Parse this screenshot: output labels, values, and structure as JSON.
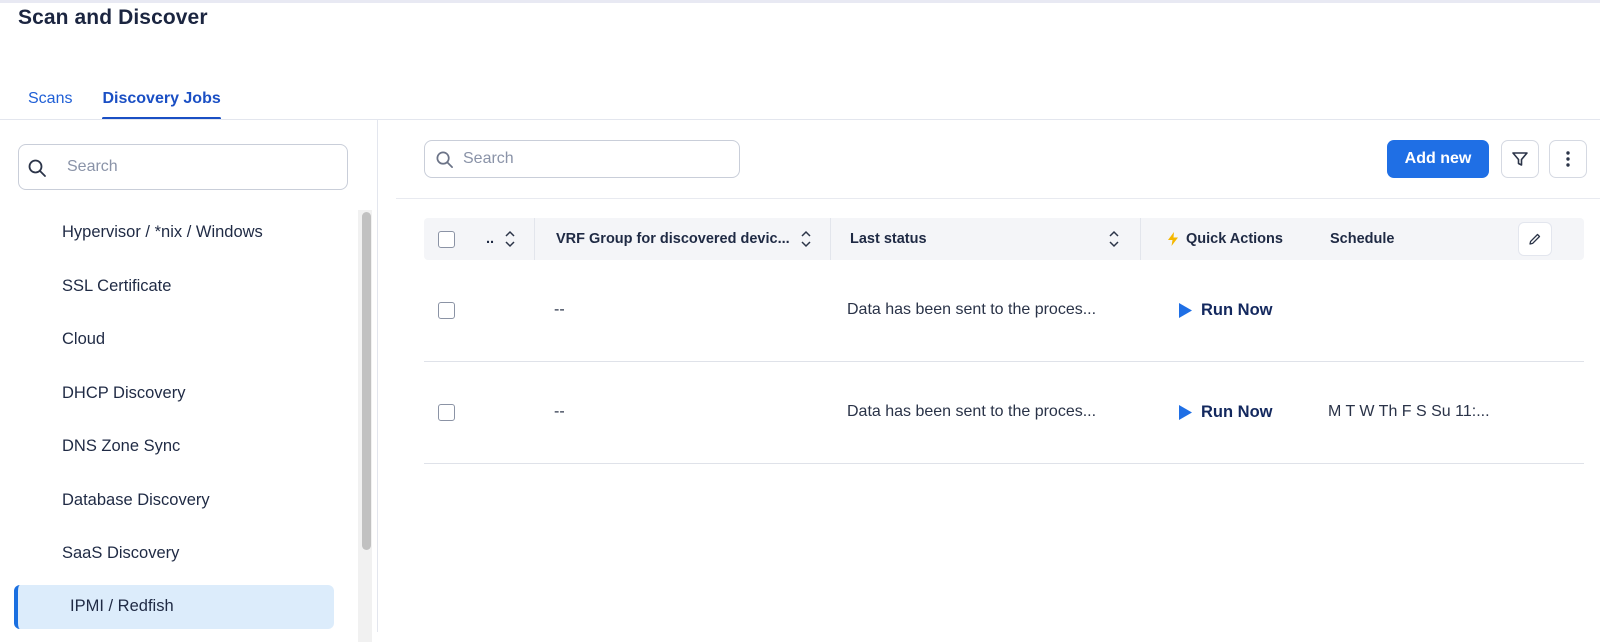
{
  "page": {
    "title": "Scan and Discover"
  },
  "tabs": [
    {
      "label": "Scans"
    },
    {
      "label": "Discovery Jobs"
    }
  ],
  "sidebar": {
    "search_placeholder": "Search",
    "items": [
      {
        "label": "Hypervisor / *nix / Windows"
      },
      {
        "label": "SSL Certificate"
      },
      {
        "label": "Cloud"
      },
      {
        "label": "DHCP Discovery"
      },
      {
        "label": "DNS Zone Sync"
      },
      {
        "label": "Database Discovery"
      },
      {
        "label": "SaaS Discovery"
      },
      {
        "label": "IPMI / Redfish"
      }
    ],
    "selected": "IPMI / Redfish"
  },
  "toolbar": {
    "search_placeholder": "Search",
    "add_label": "Add new"
  },
  "table": {
    "columns": [
      {
        "label": ".."
      },
      {
        "label": "VRF Group for discovered devic..."
      },
      {
        "label": "Last status"
      },
      {
        "label": "Quick Actions"
      },
      {
        "label": "Schedule"
      }
    ],
    "rows": [
      {
        "vrf": "--",
        "last_status": "Data has been sent to the proces...",
        "action": "Run Now",
        "schedule": ""
      },
      {
        "vrf": "--",
        "last_status": "Data has been sent to the proces...",
        "action": "Run Now",
        "schedule": "M T W Th F S Su 11:..."
      }
    ]
  },
  "colors": {
    "accent": "#1f6fe5",
    "selected_bg": "#dcecfb",
    "quick_actions_icon": "#f5b700"
  }
}
